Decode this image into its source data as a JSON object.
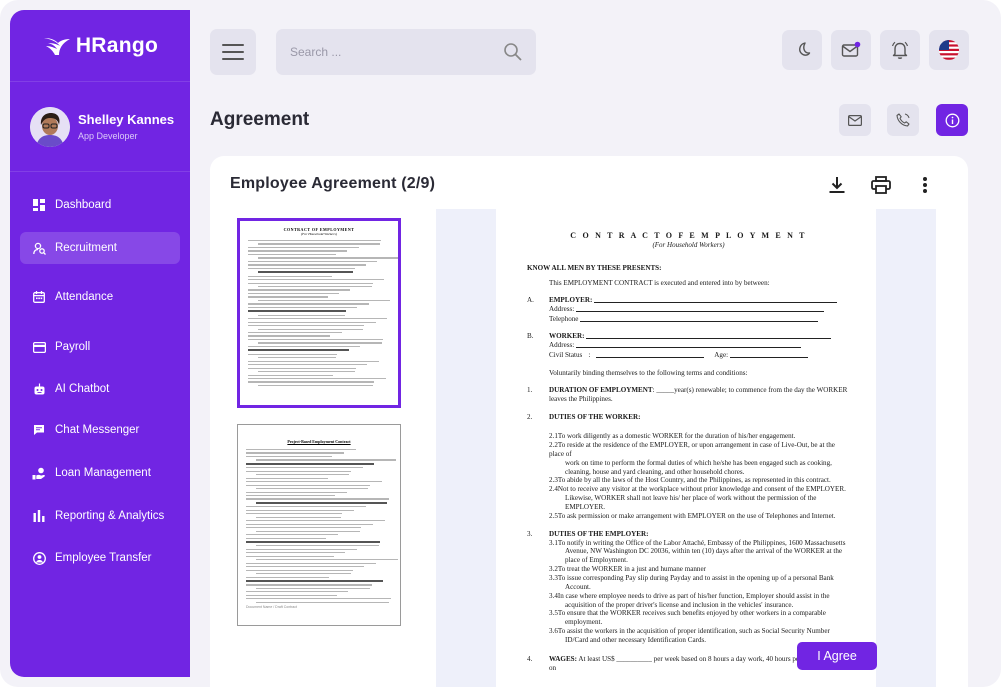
{
  "app": {
    "brand": "HRango"
  },
  "profile": {
    "name": "Shelley Kannes",
    "role": "App Developer"
  },
  "nav": [
    {
      "label": "Dashboard",
      "icon": "dashboard-icon"
    },
    {
      "label": "Recruitment",
      "icon": "recruitment-icon",
      "active": true
    },
    {
      "label": "Attendance",
      "icon": "calendar-icon"
    },
    {
      "label": "Payroll",
      "icon": "payroll-icon"
    },
    {
      "label": "AI Chatbot",
      "icon": "robot-icon"
    },
    {
      "label": "Chat Messenger",
      "icon": "chat-icon"
    },
    {
      "label": "Loan Management",
      "icon": "loan-icon"
    },
    {
      "label": "Reporting & Analytics",
      "icon": "analytics-icon"
    },
    {
      "label": "Employee Transfer",
      "icon": "transfer-icon"
    }
  ],
  "search": {
    "placeholder": "Search ..."
  },
  "colors": {
    "accent": "#7125e3",
    "surface": "#e4e3ee",
    "background": "#f3f2f8"
  },
  "page": {
    "title": "Agreement"
  },
  "card": {
    "title": "Employee Agreement (2/9)"
  },
  "document": {
    "title": "C O N T R A C T O F E M P L O Y M E N T",
    "subtitle": "(For Household Workers)",
    "know_all": "KNOW ALL MEN BY THESE PRESENTS:",
    "intro": "This EMPLOYMENT CONTRACT is executed and entered into by between:",
    "a_label": "A.",
    "a_title": "EMPLOYER:",
    "a_address": "Address:",
    "a_phone": "Telephone",
    "b_label": "B.",
    "b_title": "WORKER:",
    "b_address": "Address:",
    "b_civil": "Civil Status",
    "b_age": "Age:",
    "voluntary": "Voluntarily binding themselves to the following terms and conditions:",
    "s1_num": "1.",
    "s1_title": "DURATION OF EMPLOYMENT",
    "s1_text": ": _____year(s) renewable; to commence from the day the WORKER",
    "s1_text2": "leaves the Philippines.",
    "s2_num": "2.",
    "s2_title": "DUTIES OF THE WORKER:",
    "s2_items": [
      "2.1To work diligently as a domestic WORKER for the duration of his/her engagement.",
      "2.2To reside at the residence of the EMPLOYER, or upon arrangement in case of Live-Out, be at the place of",
      "work on time to perform the formal duties of which he/she has been engaged such as cooking,",
      "cleaning, house and yard cleaning, and other household chores.",
      "2.3To abide by all the laws of the Host Country, and the Philippines, as represented in this contract.",
      "2.4Not to receive any visitor at the workplace without prior knowledge and consent of the EMPLOYER.",
      "Likewise, WORKER shall not leave his/ her place of work without the permission of the",
      "EMPLOYER.",
      "2.5To ask permission or make arrangement with EMPLOYER on the use of Telephones and Internet."
    ],
    "s3_num": "3.",
    "s3_title": "DUTIES OF THE EMPLOYER:",
    "s3_items": [
      "3.1To notify in writing the Office of the Labor Attaché, Embassy of the Philippines, 1600 Massachusetts",
      "Avenue, NW Washington DC 20036, within ten (10) days after the arrival of the WORKER at the",
      "place of Employment.",
      "3.2To treat the WORKER in a just and humane manner",
      "3.3To issue corresponding Pay slip during Payday and to assist in the opening up of a personal Bank",
      "Account.",
      "3.4In case where employee needs to drive as part of his/her function, Employer should assist in the",
      "acquisition of the proper driver's license and inclusion in the vehicles' insurance.",
      "3.5To ensure that the WORKER receives such benefits enjoyed by other workers in a comparable",
      "employment.",
      "3.6To assist the workers in the acquisition of proper identification, such as Social Security Number",
      "ID/Card and other necessary Identification Cards."
    ],
    "s4_num": "4.",
    "s4_title": "WAGES:",
    "s4_text": "At least US$ __________ per week based on 8 hours a day work, 40 hours per week; to be paid on"
  },
  "thumb1": {
    "title": "CONTRACT OF EMPLOYMENT",
    "sub": "(For Household Workers)"
  },
  "thumb2": {
    "title": "Project-Based Employment Contract",
    "footer": "Document Name / Draft Contract"
  },
  "actions": {
    "agree": "I Agree"
  }
}
